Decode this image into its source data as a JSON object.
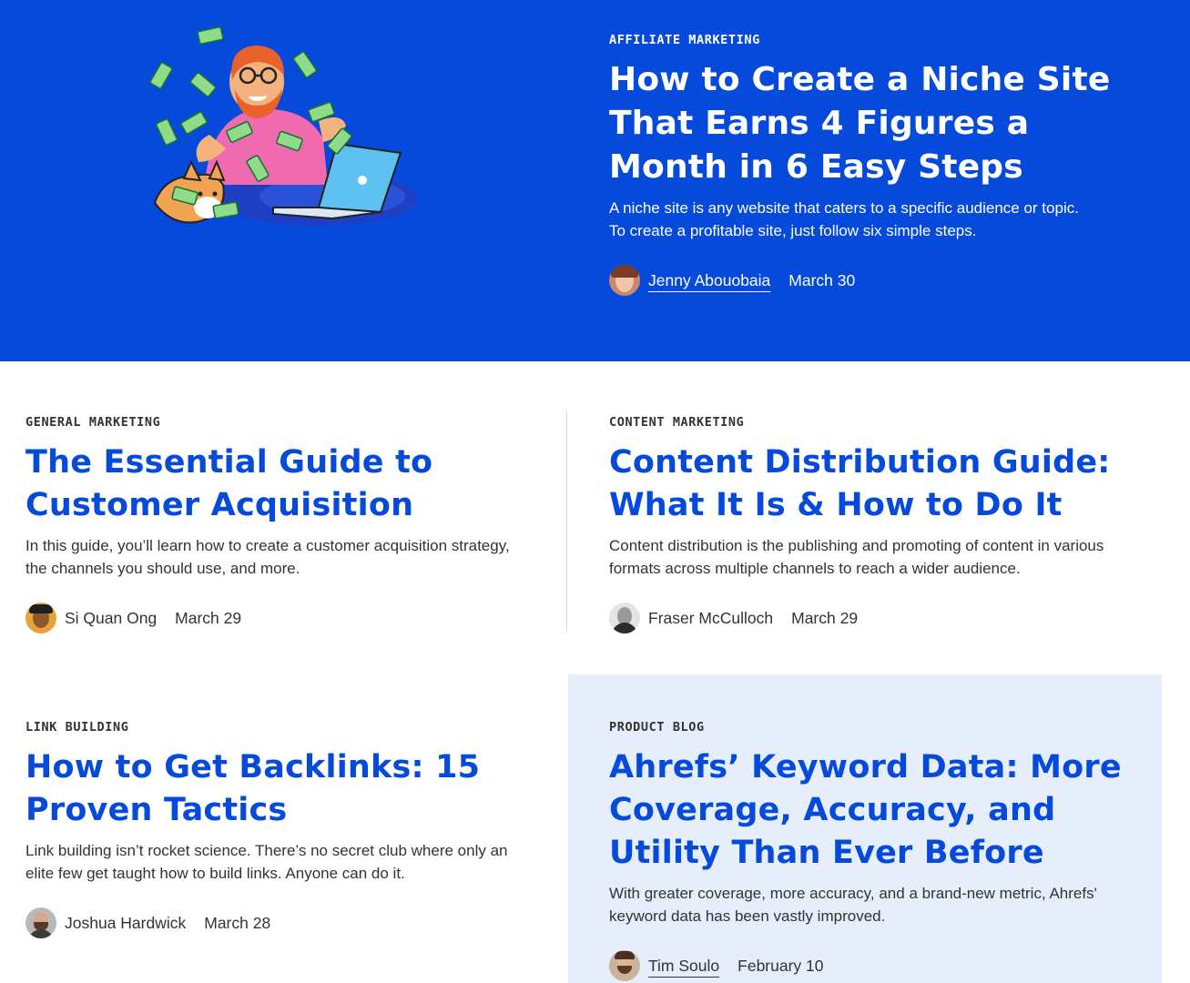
{
  "featured": {
    "category": "AFFILIATE MARKETING",
    "title": "How to Create a Niche Site That Earns 4 Figures a Month in 6 Easy Steps",
    "excerpt": "A niche site is any website that caters to a specific audience or topic. To create a profitable site, just follow six simple steps.",
    "author": "Jenny Abouobaia",
    "date": "March 30",
    "illustration_icon": "money-shower-illustration"
  },
  "articles": [
    {
      "category": "GENERAL MARKETING",
      "title": "The Essential Guide to Customer Acquisition",
      "excerpt": "In this guide, you’ll learn how to create a customer acquisition strategy, the channels you should use, and more.",
      "author": "Si Quan Ong",
      "date": "March 29"
    },
    {
      "category": "CONTENT MARKETING",
      "title": "Content Distribution Guide: What It Is & How to Do It",
      "excerpt": "Content distribution is the publishing and promoting of content in various formats across multiple channels to reach a wider audience.",
      "author": "Fraser McCulloch",
      "date": "March 29"
    },
    {
      "category": "LINK BUILDING",
      "title": "How to Get Backlinks: 15 Proven Tactics",
      "excerpt": "Link building isn’t rocket science. There’s no secret club where only an elite few get taught how to build links. Anyone can do it.",
      "author": "Joshua Hardwick",
      "date": "March 28"
    },
    {
      "category": "PRODUCT BLOG",
      "title": "Ahrefs’ Keyword Data: More Coverage, Accuracy, and Utility Than Ever Before",
      "excerpt": "With greater coverage, more accuracy, and a brand-new metric, Ahrefs' keyword data has been vastly improved.",
      "author": "Tim Soulo",
      "date": "February 10"
    }
  ],
  "colors": {
    "brand_blue": "#054ADA",
    "highlight_bg": "#E6EDFB",
    "text": "#333333"
  }
}
